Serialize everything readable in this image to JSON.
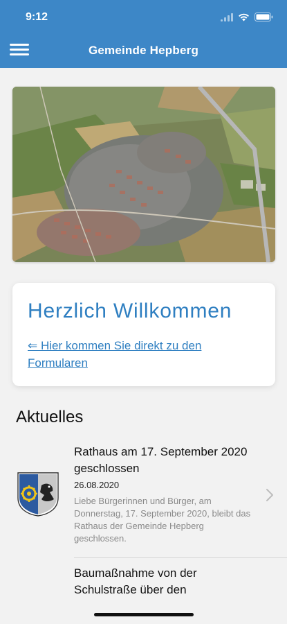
{
  "status_bar": {
    "time": "9:12"
  },
  "nav": {
    "title": "Gemeinde Hepberg"
  },
  "welcome": {
    "heading": "Herzlich Willkommen",
    "link_text": "⇐ Hier kommen Sie direkt zu den Formularen"
  },
  "news_section": {
    "title": "Aktuelles",
    "items": [
      {
        "title": "Rathaus am 17. September 2020 geschlossen",
        "date": "26.08.2020",
        "excerpt": "Liebe Bürgerinnen und Bürger,  am Donnerstag, 17. September 2020, bleibt das Rathaus der Gemeinde Hepberg geschlossen."
      },
      {
        "title": "Baumaßnahme von der Schulstraße über den"
      }
    ]
  },
  "colors": {
    "brand": "#3d87c7",
    "link": "#2f7fc1"
  }
}
